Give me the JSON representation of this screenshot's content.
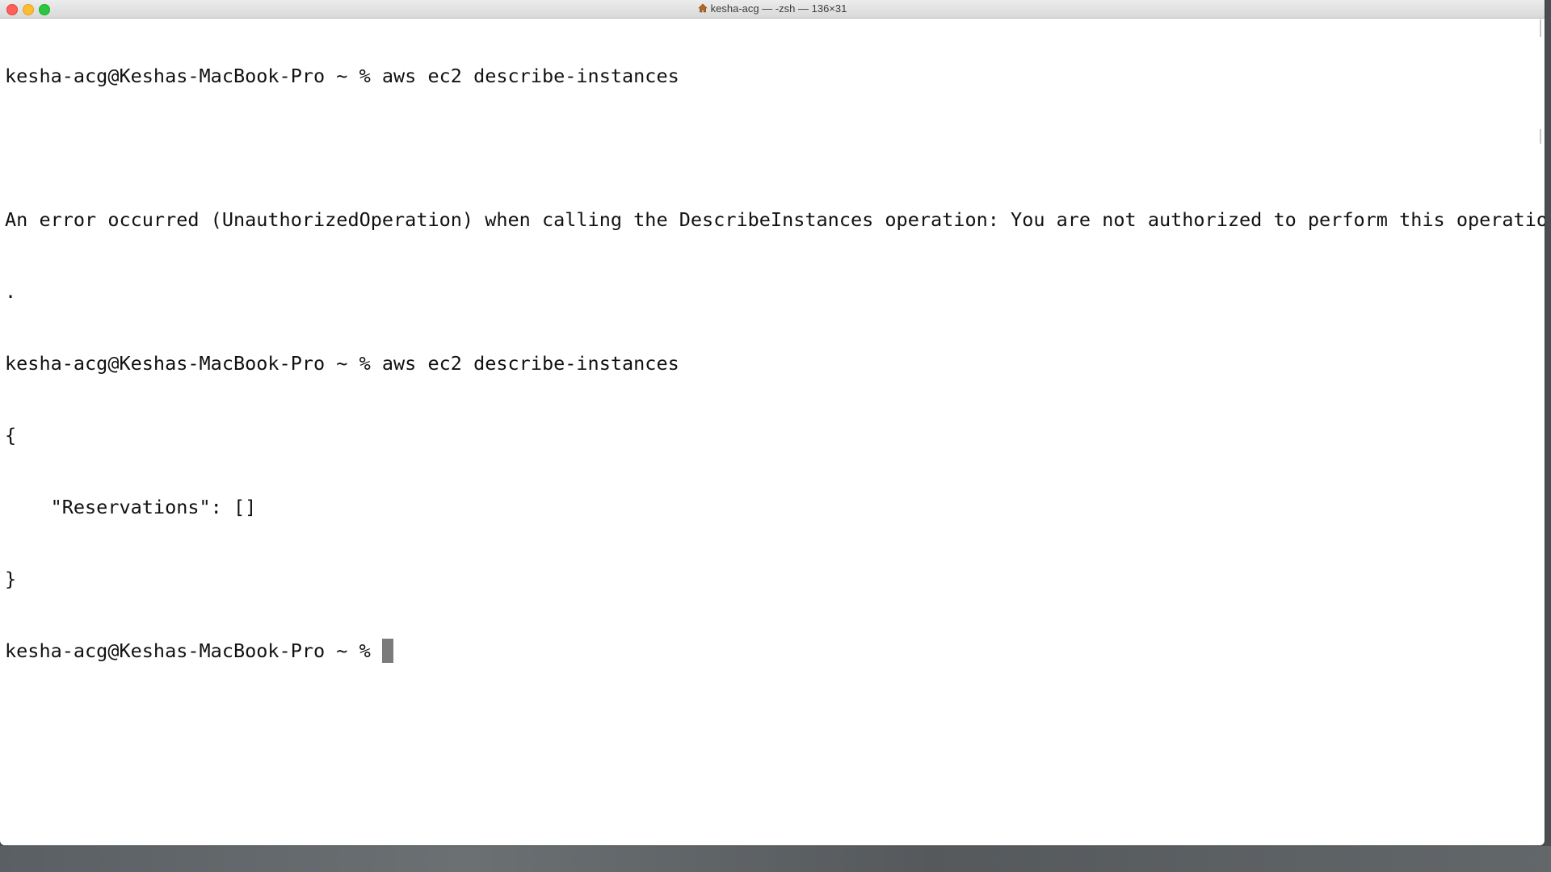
{
  "window": {
    "title": "kesha-acg — -zsh — 136×31"
  },
  "terminal": {
    "lines": [
      "kesha-acg@Keshas-MacBook-Pro ~ % aws ec2 describe-instances",
      "",
      "An error occurred (UnauthorizedOperation) when calling the DescribeInstances operation: You are not authorized to perform this operation",
      ".",
      "kesha-acg@Keshas-MacBook-Pro ~ % aws ec2 describe-instances",
      "{",
      "    \"Reservations\": []",
      "}"
    ],
    "prompt": "kesha-acg@Keshas-MacBook-Pro ~ % "
  },
  "colors": {
    "close": "#fe5f57",
    "minimize": "#febc2e",
    "maximize": "#28c840",
    "cursor": "#7b7b7b"
  },
  "icons": {
    "title": "home-icon"
  }
}
